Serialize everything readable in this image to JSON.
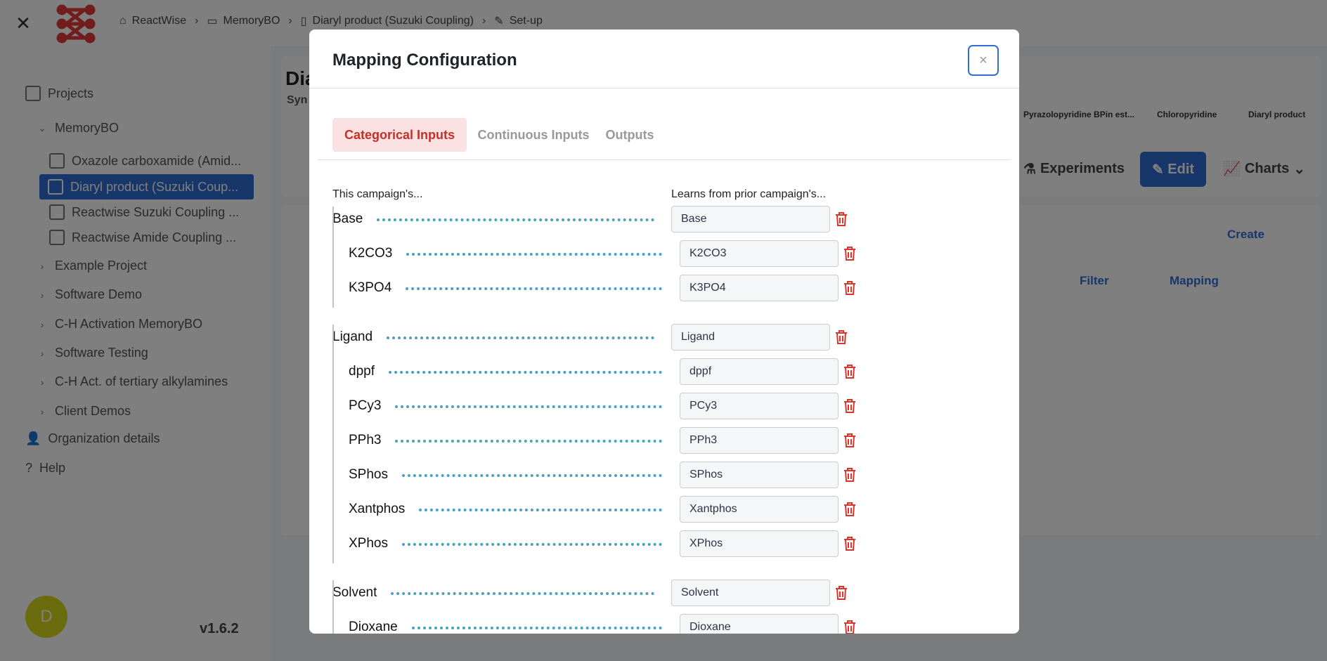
{
  "app": {
    "breadcrumbs": [
      "ReactWise",
      "MemoryBO",
      "Diaryl product (Suzuki Coupling)",
      "Set-up"
    ],
    "sidebar": {
      "projects_label": "Projects",
      "items": [
        "MemoryBO",
        "Oxazole carboxamide (Amid...",
        "Diaryl product (Suzuki Coup...",
        "Reactwise Suzuki Coupling ...",
        "Reactwise Amide Coupling ...",
        "Example Project",
        "Software Demo",
        "C-H Activation MemoryBO",
        "Software Testing",
        "C-H Act. of tertiary alkylamines",
        "Client Demos",
        "Organization details",
        "Help"
      ],
      "avatar_initial": "D",
      "version": "v1.6.2"
    },
    "main": {
      "title_partial": "Dia",
      "subtitle_partial": "Syn",
      "structures": [
        "Pyrazolopyridine BPin est...",
        "Chloropyridine",
        "Diaryl product"
      ],
      "experiments_button": "Experiments",
      "edit_button": "Edit",
      "charts_button": "Charts",
      "create_link": "Create",
      "filter_link": "Filter",
      "mapping_link": "Mapping"
    }
  },
  "modal": {
    "title": "Mapping Configuration",
    "close_symbol": "×",
    "tabs": [
      "Categorical Inputs",
      "Continuous Inputs",
      "Outputs"
    ],
    "active_tab": "Categorical Inputs",
    "col_left": "This campaign's...",
    "col_right": "Learns from prior campaign's...",
    "groups": [
      {
        "name": "Base",
        "value": "Base",
        "options": [
          {
            "name": "K2CO3",
            "value": "K2CO3"
          },
          {
            "name": "K3PO4",
            "value": "K3PO4"
          }
        ]
      },
      {
        "name": "Ligand",
        "value": "Ligand",
        "options": [
          {
            "name": "dppf",
            "value": "dppf"
          },
          {
            "name": "PCy3",
            "value": "PCy3"
          },
          {
            "name": "PPh3",
            "value": "PPh3"
          },
          {
            "name": "SPhos",
            "value": "SPhos"
          },
          {
            "name": "Xantphos",
            "value": "Xantphos"
          },
          {
            "name": "XPhos",
            "value": "XPhos"
          }
        ]
      },
      {
        "name": "Solvent",
        "value": "Solvent",
        "options": [
          {
            "name": "Dioxane",
            "value": "Dioxane"
          }
        ]
      }
    ]
  },
  "colors": {
    "accent_blue": "#2f6fd6",
    "active_tab_bg": "#fbe1e1",
    "active_tab_text": "#c3302a",
    "dotted_line": "#4aa0bf",
    "trash_red": "#d9362b"
  }
}
